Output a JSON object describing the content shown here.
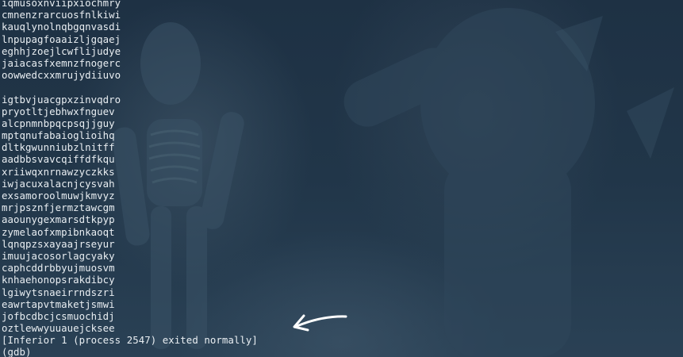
{
  "terminal": {
    "block1": [
      "iqmusoxnviipxiochmry",
      "cmnenzrarcuosfnlkiwi",
      "kauqlynolnqbgqnvasdi",
      "lnpupagfoaaizljgqaej",
      "eghhjzoejlcwflijudye",
      "jaiacasfxemnzfnogerc",
      "oowwedcxxmrujydiiuvo"
    ],
    "block2": [
      "igtbvjuacgpxzinvqdro",
      "pryotltjebhwxfnguev",
      "alcpnmnbpqcpsqjjguy",
      "mptqnufabaioglioihq",
      "dltkgwunniubzlnitff",
      "aadbbsvavcqiffdfkqu",
      "xriiwqxnrnawzyczkks",
      "iwjacuxalacnjcysvah",
      "exsamoroolmuwjkmvyz",
      "mrjpsznfjermztawcgm",
      "aaounygexmarsdtkpyp",
      "zymelaofxmpibnkaoqt",
      "lqnqpzsxayaajrseyur",
      "imuujacosorlagcyaky",
      "caphcddrbbyujmuosvm",
      "knhaehonopsrakdibcy",
      "lgiwytsnaeirrndszri",
      "eawrtapvtmaketjsmwi",
      "jofbcdbcjcsmuochidj",
      "oztlewwyuuauejcksee"
    ],
    "exit_message": "[Inferior 1 (process 2547) exited normally]",
    "prompt": "(gdb)"
  },
  "colors": {
    "background": "#1f3346",
    "text": "#e9eef2",
    "annotation_arrow": "#ffffff"
  },
  "icons": {
    "annotation": "arrow-left-icon"
  }
}
